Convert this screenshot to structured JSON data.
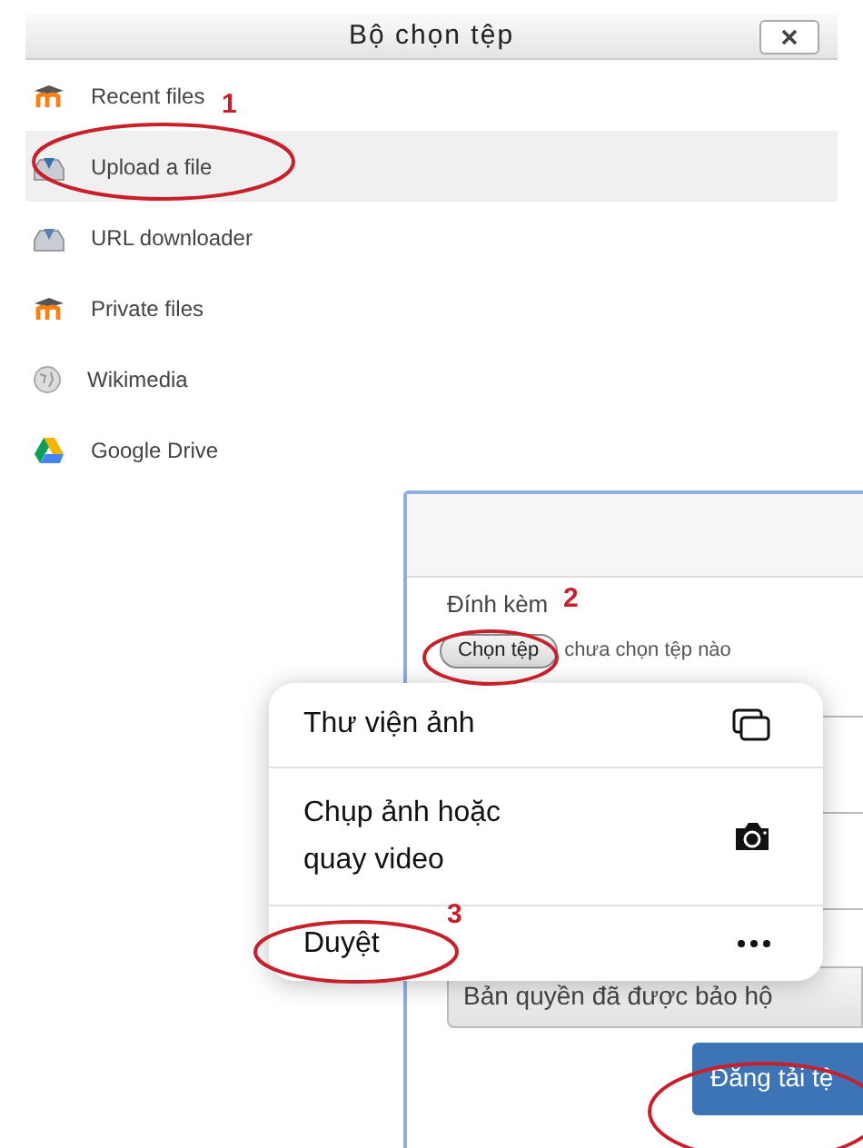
{
  "dialog": {
    "title": "Bộ chọn tệp"
  },
  "sources": [
    {
      "label": "Recent files",
      "kind": "moodle",
      "selected": false
    },
    {
      "label": "Upload a file",
      "kind": "upload",
      "selected": true
    },
    {
      "label": "URL downloader",
      "kind": "url",
      "selected": false
    },
    {
      "label": "Private files",
      "kind": "moodle",
      "selected": false
    },
    {
      "label": "Wikimedia",
      "kind": "wikimedia",
      "selected": false
    },
    {
      "label": "Google Drive",
      "kind": "drive",
      "selected": false
    }
  ],
  "upload_form": {
    "attachment_label": "Đính kèm",
    "choose_button": "Chọn tệp",
    "no_file_text": "chưa chọn tệp nào",
    "license": "Bản quyền đã được bảo hộ",
    "submit_button": "Đăng tải tệ"
  },
  "popup_menu": [
    {
      "label": "Thư viện ảnh",
      "kind": "photos"
    },
    {
      "label": "Chụp ảnh hoặc quay video",
      "kind": "camera"
    },
    {
      "label": "Duyệt",
      "kind": "more"
    }
  ],
  "annotations": [
    "1",
    "2",
    "3"
  ]
}
